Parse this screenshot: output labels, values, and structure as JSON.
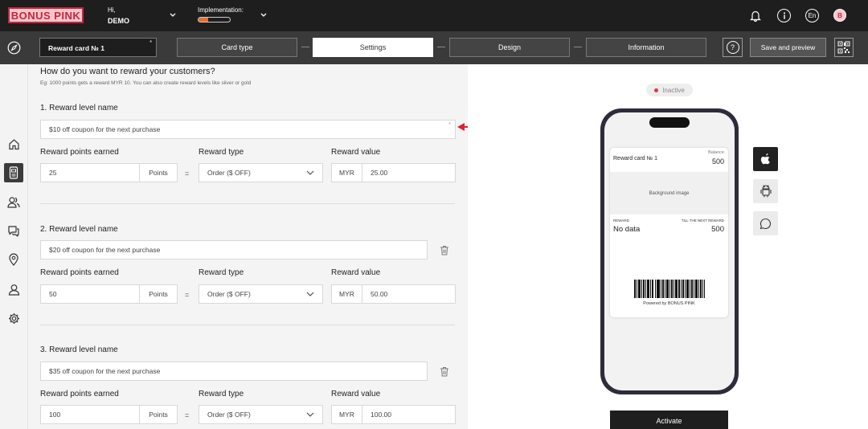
{
  "brand": {
    "logo": "BONUS PINK",
    "accent": "#c4263a",
    "logo_bg": "#f7c6cd"
  },
  "header": {
    "greeting": "Hi,",
    "user": "DEMO",
    "implementation_label": "Implementation:",
    "implementation_progress": 0.3,
    "language": "En",
    "avatar_initial": "B"
  },
  "steps": {
    "card_name": "Reward card № 1",
    "card_required": "*",
    "items": [
      "Card type",
      "Settings",
      "Design",
      "Information"
    ],
    "active": "Settings",
    "help": "?",
    "save_preview": "Save and preview"
  },
  "form": {
    "question": "How do you want to reward your customers?",
    "hint": "Eg: 1000 points gets a reward MYR 10. You can also create reward levels like silver or gold",
    "points_header": "Reward points earned",
    "type_header": "Reward type",
    "value_header": "Reward value",
    "points_suffix": "Points",
    "equals": "=",
    "currency": "MYR",
    "levels": [
      {
        "label": "1. Reward level name",
        "name": "$10 off coupon for the next purchase",
        "required": "*",
        "points": "25",
        "type": "Order ($ OFF)",
        "value": "25.00"
      },
      {
        "label": "2. Reward level name",
        "name": "$20 off coupon for the next purchase",
        "points": "50",
        "type": "Order ($ OFF)",
        "value": "50.00"
      },
      {
        "label": "3. Reward level name",
        "name": "$35 off coupon for the next purchase",
        "points": "100",
        "type": "Order ($ OFF)",
        "value": "100.00"
      }
    ]
  },
  "preview": {
    "status": "Inactive",
    "pass": {
      "title": "Reward card № 1",
      "balance_label": "Balance",
      "balance_value": "500",
      "background_label": "Background image",
      "reward_label": "REWARD",
      "reward_value": "No data",
      "next_label": "TILL THE NEXT REWARD",
      "next_value": "500",
      "powered": "Powered by BONUS PINK"
    },
    "activate": "Activate"
  }
}
